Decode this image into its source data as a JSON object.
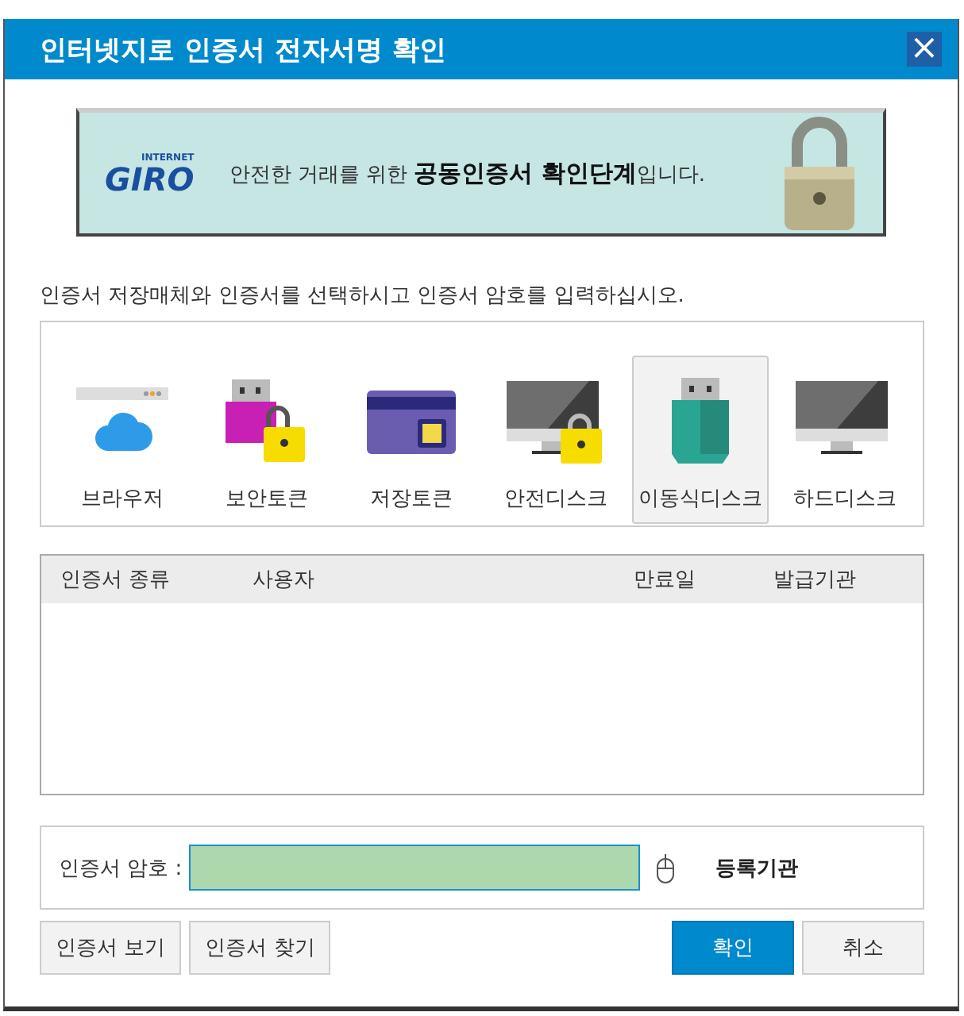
{
  "window": {
    "title": "인터넷지로 인증서 전자서명 확인",
    "close": "×"
  },
  "banner": {
    "logo_top": "INTERNET",
    "logo": "GIRO",
    "text": "안전한 거래를 위한 **공동인증서 확인단계**입니다."
  },
  "instruction": "인증서 저장매체와 인증서를 선택하시고 인증서 암호를 입력하십시오.",
  "media": [
    {
      "label": "브라우저",
      "kind": "browser",
      "selected": false
    },
    {
      "label": "보안토큰",
      "kind": "token",
      "selected": false
    },
    {
      "label": "저장토큰",
      "kind": "card",
      "selected": false
    },
    {
      "label": "안전디스크",
      "kind": "safedisk",
      "selected": false
    },
    {
      "label": "이동식디스크",
      "kind": "usb",
      "selected": true
    },
    {
      "label": "하드디스크",
      "kind": "harddisk",
      "selected": false
    }
  ],
  "table": {
    "columns": [
      "인증서 종류",
      "사용자",
      "만료일",
      "발급기관"
    ]
  },
  "password": {
    "label": "인증서 암호 :",
    "registrar": "등록기관"
  },
  "buttons": [
    {
      "label": "인증서 보기",
      "kind": "plain"
    },
    {
      "label": "인증서 찾기",
      "kind": "plain"
    },
    {
      "label": "확인",
      "kind": "primary"
    },
    {
      "label": "취소",
      "kind": "plain"
    }
  ]
}
